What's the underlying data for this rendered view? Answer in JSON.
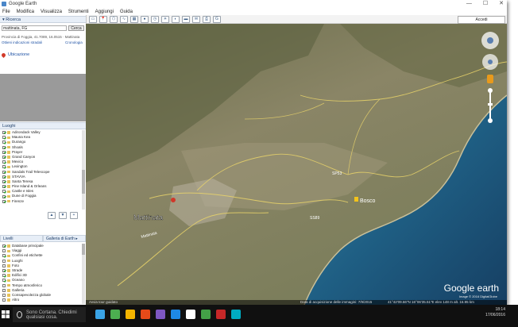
{
  "window": {
    "title": "Google Earth",
    "minimize": "—",
    "maximize": "☐",
    "close": "✕"
  },
  "menu": [
    "File",
    "Modifica",
    "Visualizza",
    "Strumenti",
    "Aggiungi",
    "Guida"
  ],
  "toolbar": {
    "signin": "Accedi"
  },
  "search": {
    "value": "mattinata, FG",
    "button": "Cerca",
    "coords": "Provincia di Foggia, 41.7089, 16.0515 · Mattinata",
    "link1": "Ottieni indicazioni stradali",
    "link2": "Cronologia",
    "result": "Ubicazione"
  },
  "places": {
    "header": "Luoghi",
    "items": [
      {
        "label": "Adirondack Valley",
        "checked": true
      },
      {
        "label": "Mauna Kea",
        "checked": true
      },
      {
        "label": "Durango",
        "checked": true
      },
      {
        "label": "Shoals",
        "checked": true
      },
      {
        "label": "Prayer",
        "checked": true
      },
      {
        "label": "Grand Canyon",
        "checked": true
      },
      {
        "label": "Mexico",
        "checked": true
      },
      {
        "label": "Lexington",
        "checked": true
      },
      {
        "label": "Sandals Trail Telescope",
        "checked": true
      },
      {
        "label": "STAVVA",
        "checked": true
      },
      {
        "label": "Santa Teresa",
        "checked": true
      },
      {
        "label": "Pine Island & Orleans",
        "checked": true
      },
      {
        "label": "Castle e Isles",
        "checked": true
      },
      {
        "label": "Dune di Foggia",
        "checked": true
      },
      {
        "label": "Firenze",
        "checked": true
      }
    ]
  },
  "layers": {
    "tab1": "Livelli",
    "tab2": "Galleria di Earth ▸",
    "items": [
      {
        "label": "Database principale",
        "checked": true
      },
      {
        "label": "Viaggi",
        "checked": false
      },
      {
        "label": "Confini ed etichette",
        "checked": true
      },
      {
        "label": "Luoghi",
        "checked": false
      },
      {
        "label": "Foto",
        "checked": false
      },
      {
        "label": "Strade",
        "checked": true
      },
      {
        "label": "Edifici 3D",
        "checked": true
      },
      {
        "label": "Oceano",
        "checked": true
      },
      {
        "label": "Tempo atmosferico",
        "checked": false
      },
      {
        "label": "Galleria",
        "checked": false
      },
      {
        "label": "Consapevolezza globale",
        "checked": false
      },
      {
        "label": "Altro",
        "checked": false
      }
    ]
  },
  "map": {
    "labels": {
      "town": "Mattinata",
      "town2": "Mattinata",
      "locality": "Bosco",
      "road1": "SP53",
      "road2": "SS89"
    },
    "status": "Data di acquisizione delle immagini: 7/9/2015",
    "coords": "41°42'09.66\"N  16°06'35.51\"E  elev 148 m  alt. 16.95 km",
    "tour": "Avvia tour guidato",
    "logo": "Google earth",
    "copyright": "Image © 2016 DigitalGlobe"
  },
  "taskbar": {
    "cortana": "Sono Cortana. Chiedimi qualsiasi cosa.",
    "time": "18:14",
    "date": "17/06/2016",
    "icon_colors": [
      "#3aa3e6",
      "#4caf50",
      "#f4b400",
      "#e64a19",
      "#7e57c2",
      "#1e88e5",
      "#ffffff",
      "#43a047",
      "#c62828",
      "#00acc1"
    ]
  }
}
